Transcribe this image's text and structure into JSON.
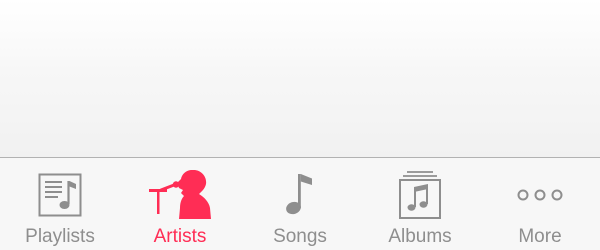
{
  "colors": {
    "active": "#ff2d55",
    "inactive": "#8e8e8e",
    "tab_bar_bg": "#f7f7f7",
    "divider": "#b2b2b2"
  },
  "tab_bar": {
    "active_tab": "Artists",
    "tabs": [
      {
        "label": "Playlists",
        "icon": "playlist-icon",
        "active": false
      },
      {
        "label": "Artists",
        "icon": "artist-singer-icon",
        "active": true
      },
      {
        "label": "Songs",
        "icon": "music-note-icon",
        "active": false
      },
      {
        "label": "Albums",
        "icon": "albums-stack-icon",
        "active": false
      },
      {
        "label": "More",
        "icon": "more-dots-icon",
        "active": false
      }
    ]
  }
}
